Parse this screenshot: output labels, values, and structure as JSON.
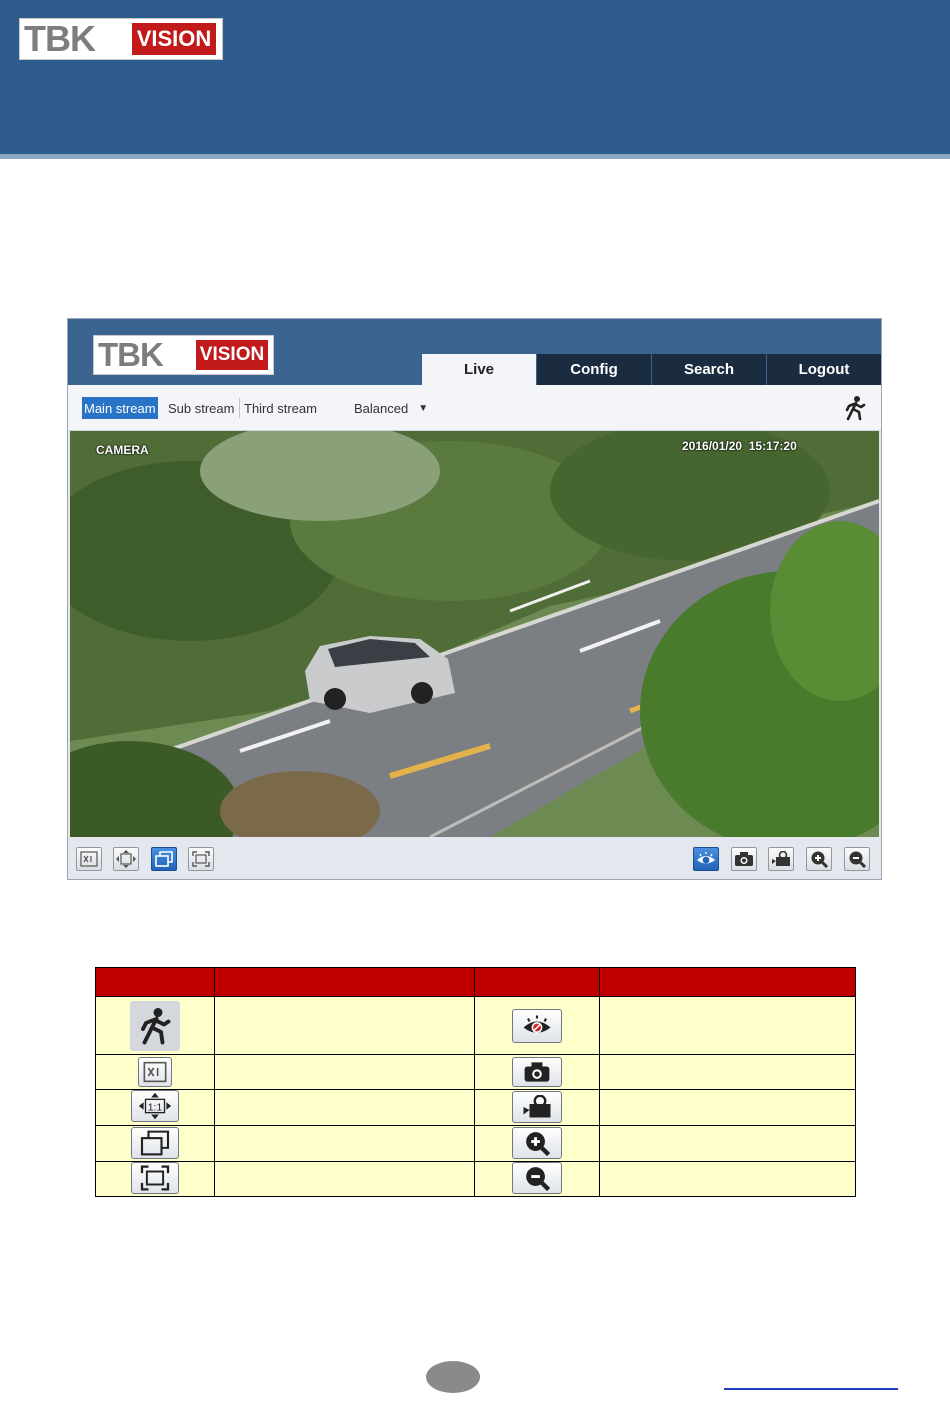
{
  "brand": {
    "logo_left": "TBK",
    "logo_right": "VISION",
    "brand_red": "#c21a1a",
    "header_blue": "#2e5c8f"
  },
  "web_ui": {
    "logo_left": "TBK",
    "logo_right": "VISION",
    "tabs": [
      {
        "label": "Live",
        "active": true
      },
      {
        "label": "Config",
        "active": false
      },
      {
        "label": "Search",
        "active": false
      },
      {
        "label": "Logout",
        "active": false
      }
    ],
    "streams": [
      {
        "label": "Main stream",
        "active": true
      },
      {
        "label": "Sub stream",
        "active": false
      },
      {
        "label": "Third stream",
        "active": false
      }
    ],
    "mode": "Balanced",
    "osd": {
      "camera_name": "CAMERA",
      "timestamp": "2016/01/20  15:17:20"
    },
    "left_tools": [
      "original-size-icon",
      "fit-window-icon",
      "window-restore-icon",
      "fullscreen-icon"
    ],
    "right_tools": [
      "eye-icon",
      "camera-snapshot-icon",
      "video-record-icon",
      "zoom-in-icon",
      "zoom-out-icon"
    ],
    "accent": "#2a74c7"
  },
  "legend": {
    "header_color": "#c00000",
    "cell_color": "#ffffcc",
    "rows": [
      {
        "left_icon": "walker-icon",
        "right_icon": "eye-icon"
      },
      {
        "left_icon": "original-size-icon",
        "right_icon": "camera-snapshot-icon"
      },
      {
        "left_icon": "fit-window-icon",
        "right_icon": "video-record-icon"
      },
      {
        "left_icon": "window-restore-icon",
        "right_icon": "zoom-in-icon"
      },
      {
        "left_icon": "fullscreen-icon",
        "right_icon": "zoom-out-icon"
      }
    ]
  }
}
